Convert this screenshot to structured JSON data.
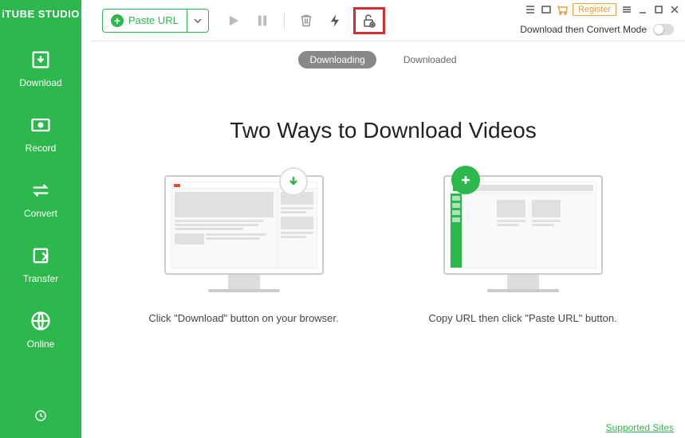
{
  "app_name": "iTUBE STUDIO",
  "sidebar": {
    "items": [
      {
        "label": "Download"
      },
      {
        "label": "Record"
      },
      {
        "label": "Convert"
      },
      {
        "label": "Transfer"
      },
      {
        "label": "Online"
      }
    ]
  },
  "toolbar": {
    "paste_url_label": "Paste URL"
  },
  "window": {
    "register_label": "Register"
  },
  "mode": {
    "label": "Download then Convert Mode"
  },
  "tabs": {
    "downloading": "Downloading",
    "downloaded": "Downloaded"
  },
  "content": {
    "title": "Two Ways to Download Videos",
    "method1_text": "Click \"Download\" button on your browser.",
    "method2_text": "Copy URL then click \"Paste URL\" button."
  },
  "footer": {
    "supported_sites": "Supported Sites"
  }
}
